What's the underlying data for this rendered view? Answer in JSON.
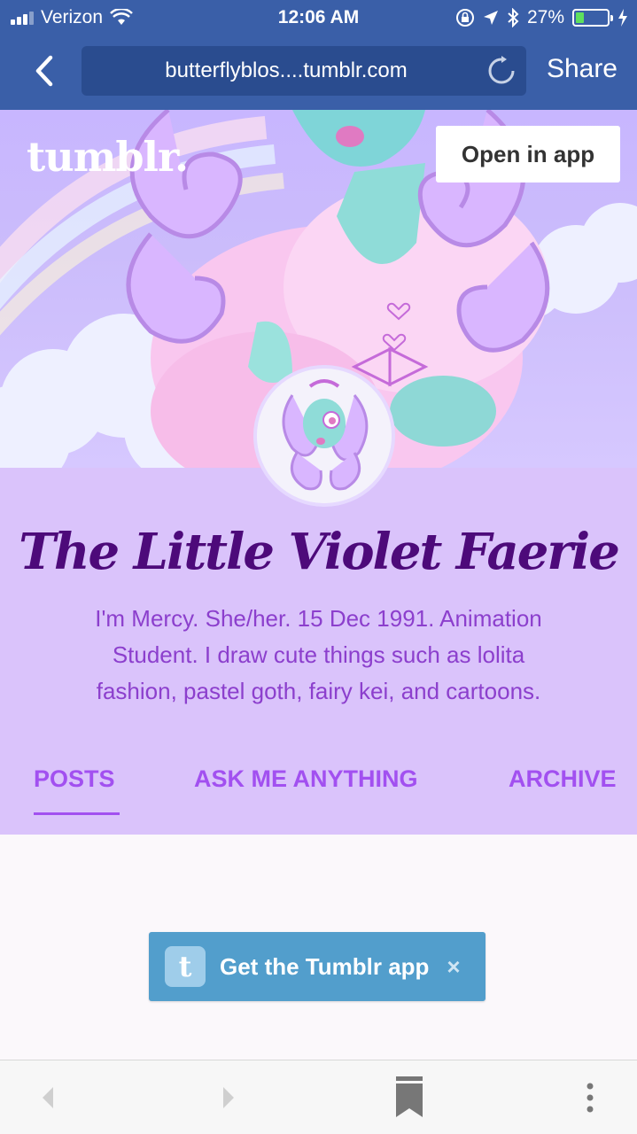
{
  "status_bar": {
    "carrier": "Verizon",
    "time": "12:06 AM",
    "battery_percent": "27%",
    "battery_level": 0.27,
    "battery_color": "#5ee05e",
    "icons": [
      "signal-icon",
      "wifi-icon",
      "orientation-lock-icon",
      "location-icon",
      "bluetooth-icon",
      "battery-icon",
      "charging-icon"
    ]
  },
  "browser": {
    "url": "butterflyblos....tumblr.com",
    "share_label": "Share",
    "back_icon": "chevron-left-icon",
    "reload_icon": "reload-icon"
  },
  "header": {
    "logo_text": "tumblr.",
    "open_in_app_label": "Open in app"
  },
  "profile": {
    "blog_title": "The Little Violet Faerie",
    "bio": "I'm Mercy. She/her. 15 Dec 1991. Animation Student. I draw cute things such as lolita fashion, pastel goth, fairy kei, and cartoons.",
    "tabs": [
      {
        "label": "POSTS",
        "active": true
      },
      {
        "label": "ASK ME ANYTHING",
        "active": false
      },
      {
        "label": "ARCHIVE",
        "active": false
      }
    ]
  },
  "banner": {
    "get_app_label": "Get the Tumblr app",
    "app_icon_letter": "t",
    "close_glyph": "×"
  },
  "toolbar": {
    "items": [
      "back-arrow-icon",
      "forward-arrow-icon",
      "bookmark-icon",
      "more-options-icon"
    ]
  },
  "colors": {
    "chrome": "#3a5fa8",
    "url_field": "#2a4c8f",
    "profile_bg": "#dac3fb",
    "title": "#4d0a7a",
    "bio": "#8c3fcd",
    "tab": "#a250f0",
    "get_app_bg": "#529ecc"
  }
}
